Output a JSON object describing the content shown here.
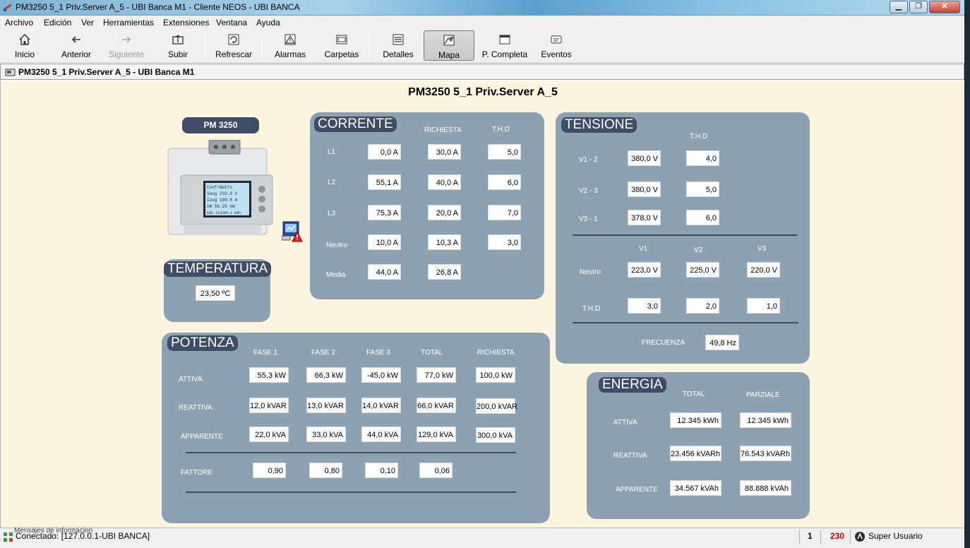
{
  "window": {
    "title": "PM3250 5_1 Priv.Server A_5 - UBI Banca M1 - Cliente NEOS - UBI BANCA",
    "minimize": "▁",
    "maximize": "❐",
    "close": "✕"
  },
  "menu": [
    "Archivo",
    "Edición",
    "Ver",
    "Herramientas",
    "Extensiones",
    "Ventana",
    "Ayuda"
  ],
  "toolbar": [
    {
      "label": "Inicio",
      "icon": "home-icon"
    },
    {
      "label": "Anterior",
      "icon": "arrow-left-icon"
    },
    {
      "label": "Siguiente",
      "icon": "arrow-right-icon",
      "disabled": true
    },
    {
      "label": "Subir",
      "icon": "folder-up-icon"
    },
    {
      "label": "Refrescar",
      "icon": "refresh-icon"
    },
    {
      "label": "Alarmas",
      "icon": "alarm-icon"
    },
    {
      "label": "Carpetas",
      "icon": "folders-icon"
    },
    {
      "label": "Detalles",
      "icon": "details-icon"
    },
    {
      "label": "Mapa",
      "icon": "map-icon",
      "active": true
    },
    {
      "label": "P. Completa",
      "icon": "fullscreen-icon"
    },
    {
      "label": "Eventos",
      "icon": "events-icon"
    }
  ],
  "breadcrumb": "PM3250 5_1 Priv.Server A_5 - UBI Banca M1",
  "page_title": "PM3250 5_1 Priv.Server A_5",
  "device": {
    "badge": "PM 3250",
    "screen_lines": [
      "Conf/Watts",
      "Vavg  232.0 V",
      "Iavg  100.8 A",
      "kW  56.25 kW",
      "kWh  113284.1 kWh"
    ]
  },
  "temperatura": {
    "title": "TEMPERATURA",
    "value": "23,50 ºC"
  },
  "corriente": {
    "title": "CORRENTE",
    "col_richiesta": "RICHIESTA",
    "col_thd": "T.H.D",
    "rows": [
      {
        "label": "L1",
        "value": "0,0 A",
        "richiesta": "30,0 A",
        "thd": "5,0"
      },
      {
        "label": "L2",
        "value": "55,1 A",
        "richiesta": "40,0 A",
        "thd": "6,0"
      },
      {
        "label": "L3",
        "value": "75,3 A",
        "richiesta": "20,0 A",
        "thd": "7,0"
      },
      {
        "label": "Neutro",
        "value": "10,0 A",
        "richiesta": "10,3 A",
        "thd": "3,0"
      },
      {
        "label": "Media",
        "value": "44,0 A",
        "richiesta": "26,8 A",
        "thd": ""
      }
    ]
  },
  "tensione": {
    "title": "TENSIONE",
    "col_thd": "T.H.D",
    "rows": [
      {
        "label": "V1 - 2",
        "value": "380,0 V",
        "thd": "4,0"
      },
      {
        "label": "V2 - 3",
        "value": "380,0 V",
        "thd": "5,0"
      },
      {
        "label": "V3 - 1",
        "value": "378,0 V",
        "thd": "6,0"
      }
    ],
    "phase_headers": [
      "V1",
      "V2",
      "V3"
    ],
    "neutro_label": "Neutro",
    "neutro_values": [
      "223,0 V",
      "225,0 V",
      "220,0 V"
    ],
    "thd_label": "T.H.D",
    "thd_values": [
      "3,0",
      "2,0",
      "1,0"
    ],
    "frecuenza_label": "FRECUENZA",
    "frecuenza_value": "49,8 Hz"
  },
  "potenza": {
    "title": "POTENZA",
    "columns": [
      "FASE 1",
      "FASE 2",
      "FASE 3",
      "TOTAL",
      "RICHIESTA"
    ],
    "rows": [
      {
        "label": "ATTIVA",
        "values": [
          "55,3 kW",
          "66,3 kW",
          "-45,0 kW",
          "77,0 kW",
          "100,0 kW"
        ]
      },
      {
        "label": "REATTIVA",
        "values": [
          "12,0 kVAR",
          "13,0 kVAR",
          "14,0 kVAR",
          "66,0 kVAR",
          "200,0 kVAR"
        ]
      },
      {
        "label": "APPARENTE",
        "values": [
          "22,0 kVA",
          "33,0 kVA",
          "44,0 kVA",
          "129,0 kVA",
          "300,0 kVA"
        ]
      }
    ],
    "fattore_label": "FATTORE",
    "fattore_values": [
      "0,90",
      "0,80",
      "0,10",
      "0,06"
    ]
  },
  "energia": {
    "title": "ENERGIA",
    "col_total": "TOTAL",
    "col_parziale": "PARZIALE",
    "rows": [
      {
        "label": "ATTIVA",
        "total": "12.345 kWh",
        "parziale": "12.345 kWh"
      },
      {
        "label": "REATTIVA",
        "total": "23.456 kVARh",
        "parziale": "76.543 kVARh"
      },
      {
        "label": "APPARENTE",
        "total": "34.567 kVAh",
        "parziale": "88.888 kVAh"
      }
    ]
  },
  "status": {
    "hidden_strip": "Mensajes de informacion",
    "connection": "Conectado: [127.0.0.1-UBI BANCA]",
    "count1": "1",
    "count2": "230",
    "count2_color": "#cc0000",
    "user": "Super Usuario"
  }
}
